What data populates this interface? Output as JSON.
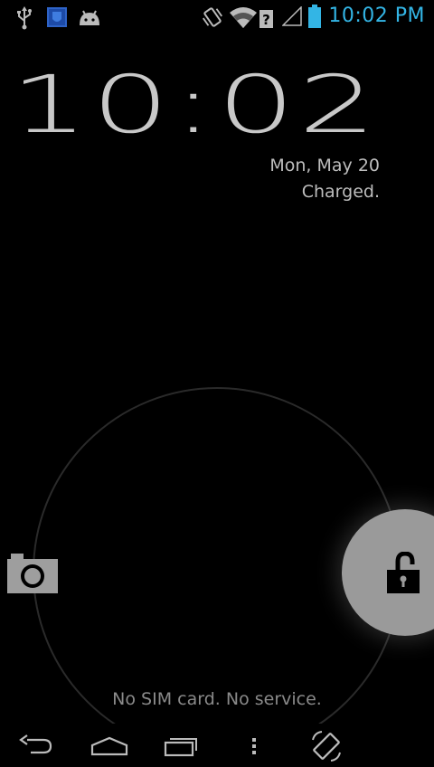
{
  "status_bar": {
    "time": "10:02 PM",
    "time_color": "#33b5e5",
    "left_icons": [
      "usb-icon",
      "app-notification-icon",
      "android-debug-icon"
    ],
    "right_icons": [
      "vibrate-icon",
      "wifi-unknown-icon",
      "no-signal-icon",
      "battery-full-icon"
    ]
  },
  "lockscreen": {
    "clock_time": "10:02",
    "date": "Mon, May 20",
    "charge_status": "Charged.",
    "carrier_text": "No SIM card. No service."
  },
  "unlock_widget": {
    "left_target": "camera-icon",
    "handle": "unlock-icon"
  },
  "nav_bar": {
    "buttons": [
      "back-icon",
      "home-icon",
      "recent-apps-icon",
      "menu-icon",
      "rotate-icon"
    ]
  }
}
